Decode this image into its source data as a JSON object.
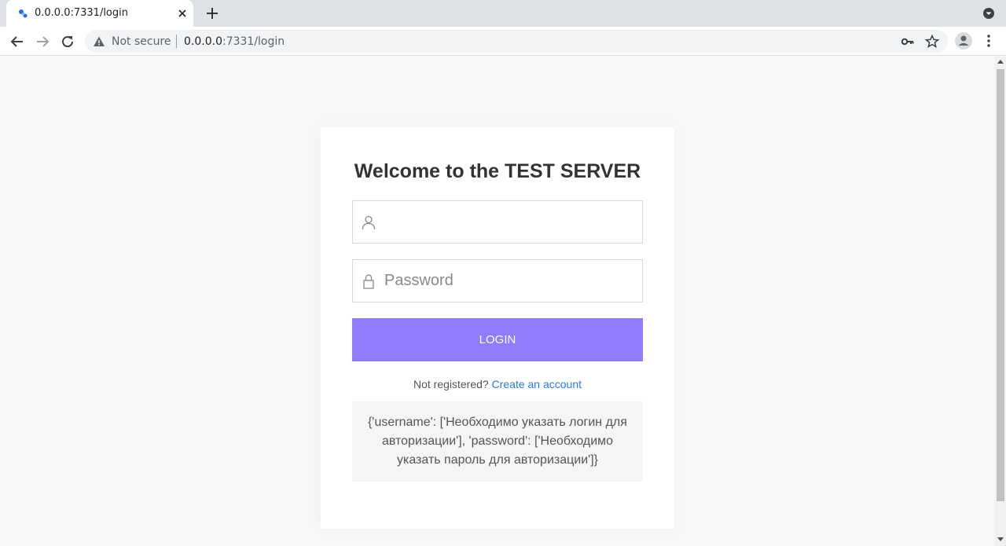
{
  "browser": {
    "tab_title": "0.0.0.0:7331/login",
    "security_label": "Not secure",
    "url_host": "0.0.0.0",
    "url_rest": ":7331/login"
  },
  "login": {
    "heading": "Welcome to the TEST SERVER",
    "username_value": "",
    "username_placeholder": "",
    "password_placeholder": "Password",
    "button_label": "LOGIN",
    "register_text": "Not registered?",
    "register_link": "Create an account",
    "error_message": "{'username': ['Необходимо указать логин для авторизации'], 'password': ['Необходимо указать пароль для авторизации']}"
  },
  "colors": {
    "accent": "#8f7cff",
    "link": "#2a7ae2",
    "page_bg": "#f7f7f7",
    "error_bg": "#f5f5f5"
  },
  "icons": {
    "username": "user-icon",
    "password": "lock-icon"
  }
}
